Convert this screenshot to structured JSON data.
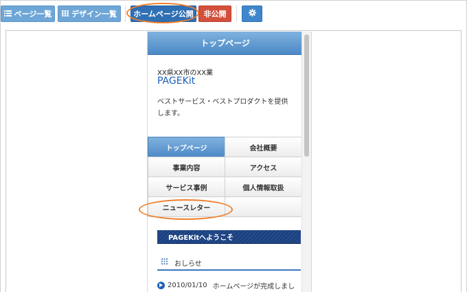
{
  "toolbar": {
    "page_list": {
      "label": "ページ一覧",
      "icon": "list-icon"
    },
    "design_list": {
      "label": "デザイン一覧",
      "icon": "grid-icon"
    },
    "publish": {
      "label": "ホームページ公開"
    },
    "unpublish": {
      "label": "非公開"
    },
    "settings": {
      "icon": "gear-icon"
    }
  },
  "preview": {
    "header_title": "トップページ",
    "tagline": "XX県XX市のXX業",
    "logo": "PAGEKit",
    "description": "ベストサービス・ベストプロダクトを提供します。",
    "menu": [
      {
        "label": "トップページ",
        "active": true
      },
      {
        "label": "会社概要",
        "active": false
      },
      {
        "label": "事業内容",
        "active": false
      },
      {
        "label": "アクセス",
        "active": false
      },
      {
        "label": "サービス事例",
        "active": false
      },
      {
        "label": "個人情報取扱",
        "active": false
      },
      {
        "label": "ニュースレター",
        "active": false
      },
      {
        "label": "",
        "active": false
      }
    ],
    "welcome_banner": "PAGEKitへようこそ",
    "news_heading": "おしらせ",
    "news_items": [
      {
        "date": "2010/01/10",
        "text": "ホームページが完成しまし"
      }
    ]
  },
  "colors": {
    "accent_blue": "#2f6fb4",
    "light_blue": "#6ea6d7",
    "red": "#d2503c",
    "highlight_orange": "#f07f2c",
    "link_blue": "#1a5fbd"
  }
}
